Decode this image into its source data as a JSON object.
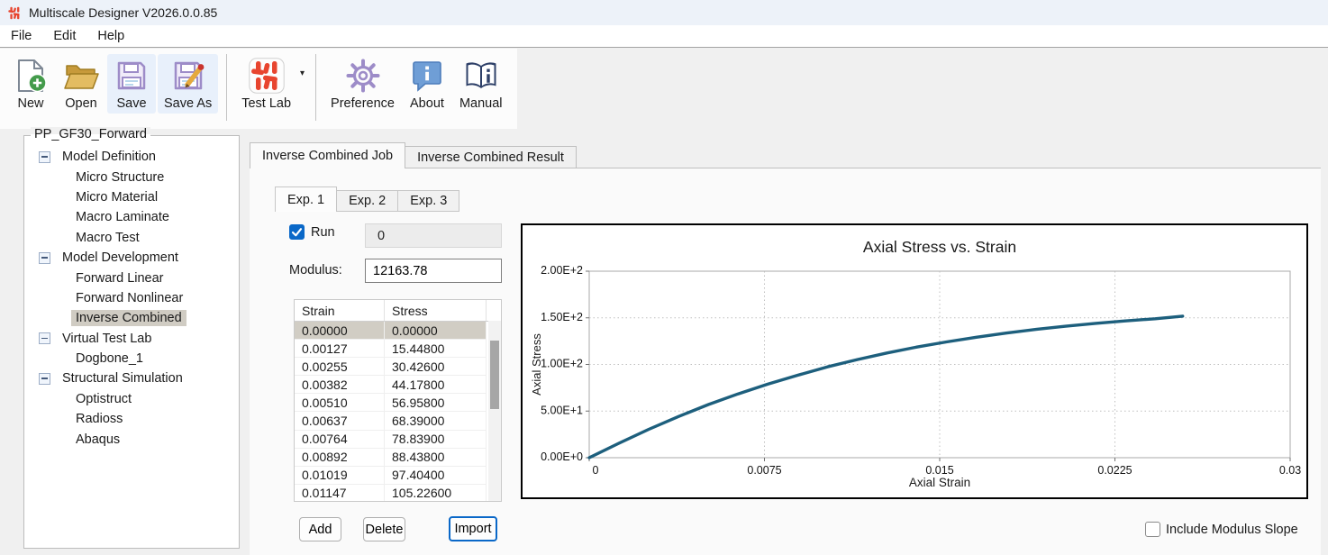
{
  "window": {
    "title": "Multiscale Designer V2026.0.0.85"
  },
  "menu": {
    "items": [
      "File",
      "Edit",
      "Help"
    ]
  },
  "toolbar": {
    "buttons": [
      {
        "label": "New",
        "icon": "new-document-icon"
      },
      {
        "label": "Open",
        "icon": "open-folder-icon"
      },
      {
        "label": "Save",
        "icon": "save-icon",
        "highlight": true
      },
      {
        "label": "Save As",
        "icon": "save-as-icon",
        "highlight": true
      },
      {
        "separator": true
      },
      {
        "label": "Test Lab",
        "icon": "test-lab-icon",
        "dropdown": true
      },
      {
        "separator": true
      },
      {
        "label": "Preference",
        "icon": "preference-gear-icon"
      },
      {
        "label": "About",
        "icon": "about-info-icon"
      },
      {
        "label": "Manual",
        "icon": "manual-book-icon"
      }
    ]
  },
  "tree": {
    "group_label": "PP_GF30_Forward",
    "items": [
      {
        "label": "Model Definition",
        "level": 0,
        "expander": true
      },
      {
        "label": "Micro Structure",
        "level": 1
      },
      {
        "label": "Micro Material",
        "level": 1
      },
      {
        "label": "Macro Laminate",
        "level": 1
      },
      {
        "label": "Macro Test",
        "level": 1
      },
      {
        "label": "Model Development",
        "level": 0,
        "expander": true
      },
      {
        "label": "Forward Linear",
        "level": 1
      },
      {
        "label": "Forward Nonlinear",
        "level": 1
      },
      {
        "label": "Inverse Combined",
        "level": 1,
        "selected": true
      },
      {
        "label": "Virtual Test Lab",
        "level": 0,
        "expander": true
      },
      {
        "label": "Dogbone_1",
        "level": 1
      },
      {
        "label": "Structural Simulation",
        "level": 0,
        "expander": true
      },
      {
        "label": "Optistruct",
        "level": 1
      },
      {
        "label": "Radioss",
        "level": 1
      },
      {
        "label": "Abaqus",
        "level": 1
      }
    ]
  },
  "tabs": {
    "main": [
      {
        "label": "Inverse Combined Job",
        "active": true
      },
      {
        "label": "Inverse Combined Result",
        "active": false
      }
    ],
    "experiments": [
      {
        "label": "Exp. 1",
        "active": true
      },
      {
        "label": "Exp. 2",
        "active": false
      },
      {
        "label": "Exp. 3",
        "active": false
      }
    ]
  },
  "form": {
    "run_label": "Run",
    "run_checked": true,
    "run_value": "0",
    "modulus_label": "Modulus:",
    "modulus_value": "12163.78"
  },
  "table": {
    "columns": [
      "Strain",
      "Stress"
    ],
    "selected_row": 0,
    "rows": [
      [
        "0.00000",
        "0.00000"
      ],
      [
        "0.00127",
        "15.44800"
      ],
      [
        "0.00255",
        "30.42600"
      ],
      [
        "0.00382",
        "44.17800"
      ],
      [
        "0.00510",
        "56.95800"
      ],
      [
        "0.00637",
        "68.39000"
      ],
      [
        "0.00764",
        "78.83900"
      ],
      [
        "0.00892",
        "88.43800"
      ],
      [
        "0.01019",
        "97.40400"
      ],
      [
        "0.01147",
        "105.22600"
      ]
    ]
  },
  "actions": {
    "add": "Add",
    "delete": "Delete",
    "import": "Import"
  },
  "options": {
    "include_modulus_slope_label": "Include Modulus Slope",
    "include_modulus_slope_checked": false
  },
  "chart_data": {
    "type": "line",
    "title": "Axial Stress vs. Strain",
    "xlabel": "Axial Strain",
    "ylabel": "Axial Stress",
    "xlim": [
      0,
      0.03
    ],
    "ylim": [
      0,
      200
    ],
    "grid": true,
    "legend": "none",
    "line_color": "#1d5f7d",
    "xticks": {
      "values": [
        0,
        0.0075,
        0.015,
        0.0225,
        0.03
      ],
      "labels": [
        "0",
        "0.0075",
        "0.015",
        "0.0225",
        "0.03"
      ]
    },
    "yticks": {
      "values": [
        0,
        50,
        100,
        150,
        200
      ],
      "labels": [
        "0.00E+0",
        "5.00E+1",
        "1.00E+2",
        "1.50E+2",
        "2.00E+2"
      ]
    },
    "series": [
      {
        "name": "Axial Stress",
        "points": [
          [
            0.0,
            0.0
          ],
          [
            0.00127,
            15.448
          ],
          [
            0.00255,
            30.426
          ],
          [
            0.00382,
            44.178
          ],
          [
            0.0051,
            56.958
          ],
          [
            0.00637,
            68.39
          ],
          [
            0.00764,
            78.839
          ],
          [
            0.00892,
            88.438
          ],
          [
            0.01019,
            97.404
          ],
          [
            0.01147,
            105.226
          ],
          [
            0.01274,
            112.3
          ],
          [
            0.01402,
            118.6
          ],
          [
            0.01529,
            124.2
          ],
          [
            0.01657,
            129.2
          ],
          [
            0.01784,
            133.6
          ],
          [
            0.01912,
            137.6
          ],
          [
            0.02039,
            141.0
          ],
          [
            0.02167,
            144.1
          ],
          [
            0.02294,
            146.7
          ],
          [
            0.02422,
            149.0
          ],
          [
            0.0254,
            151.8
          ]
        ]
      }
    ]
  }
}
